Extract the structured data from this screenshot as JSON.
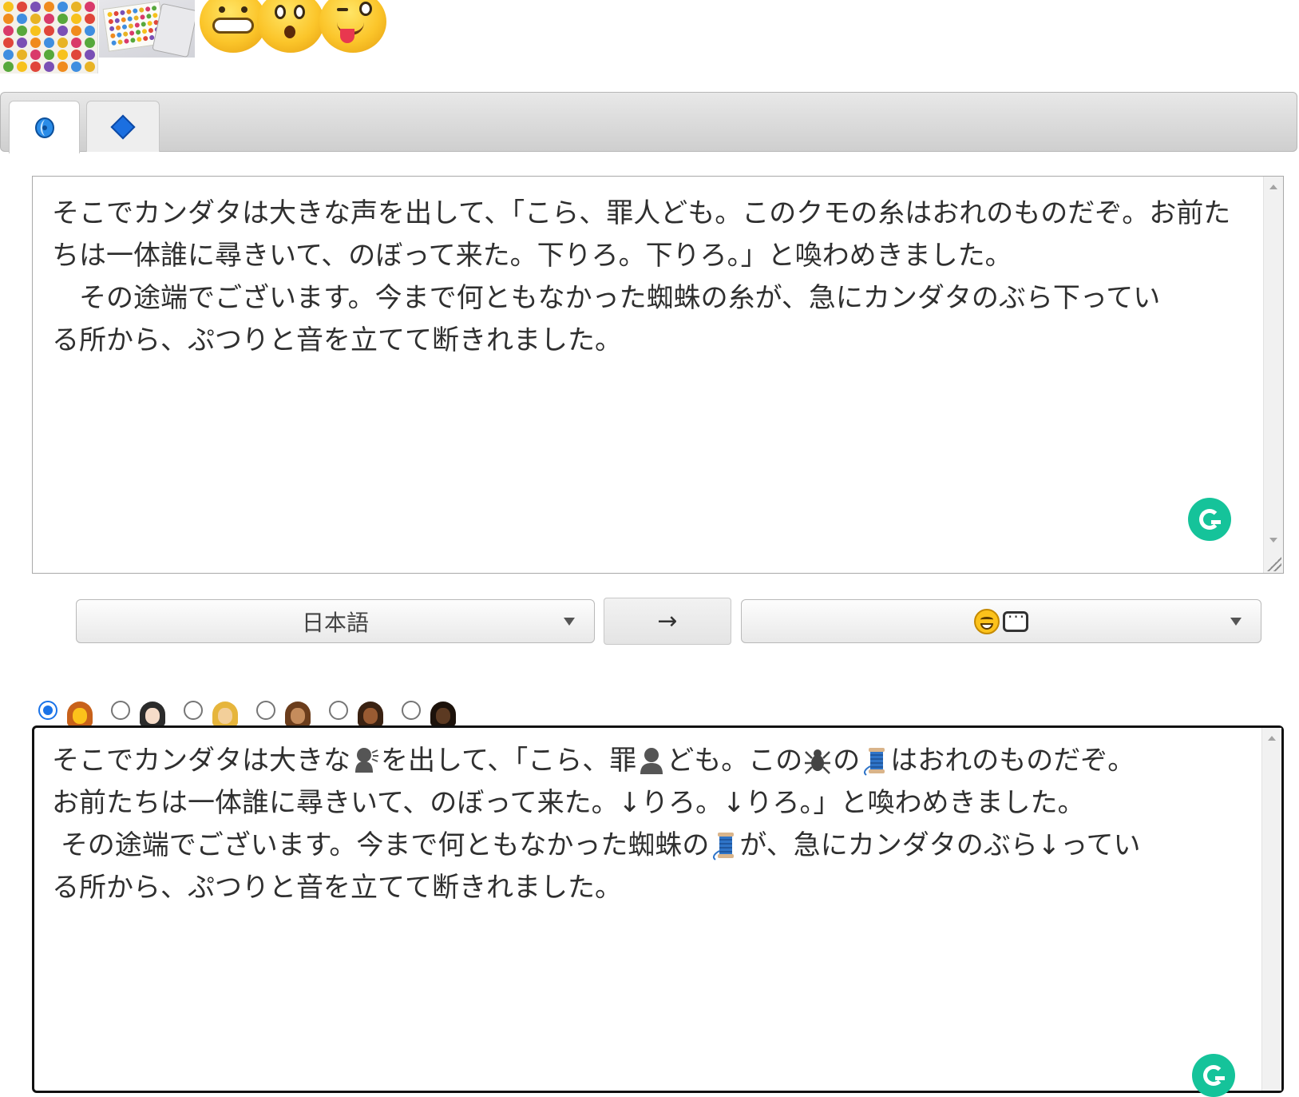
{
  "top_images": {
    "items": [
      "emoji-grid-image",
      "emoji-keyboard-image",
      "emoji-faces-image"
    ]
  },
  "tabs": [
    {
      "name": "translate-tab",
      "icon": "swirl-icon",
      "active": true
    },
    {
      "name": "emoji-tab",
      "icon": "diamond-icon",
      "active": false
    }
  ],
  "input": {
    "text": "そこでカンダタは大きな声を出して、「こら、罪人ども。このクモの糸はおれのものだぞ。お前たちは一体誰に尋きいて、のぼって来た。下りろ。下りろ。」と喚わめきました。\n　その途端でございます。今まで何ともなかった蜘蛛の糸が、急にカンダタのぶら下ってい\nる所から、ぷつりと音を立てて断きれました。"
  },
  "controls": {
    "source_language": "日本語",
    "swap_label": "→",
    "target_language_icons": [
      "grinning-face-icon",
      "speech-bubble-icon"
    ]
  },
  "skin_tones": {
    "selected_index": 0,
    "options": [
      "default",
      "light",
      "medium-light",
      "medium",
      "medium-dark",
      "dark"
    ],
    "colors": [
      {
        "hair": "#c8611a",
        "skin": "#fcc21b"
      },
      {
        "hair": "#2b2b2b",
        "skin": "#f6dcc9"
      },
      {
        "hair": "#e6b53c",
        "skin": "#f3cf9a"
      },
      {
        "hair": "#6b3d1c",
        "skin": "#c58c5c"
      },
      {
        "hair": "#3a2212",
        "skin": "#9a5b32"
      },
      {
        "hair": "#1c120b",
        "skin": "#5c3a22"
      }
    ]
  },
  "output": {
    "segments": [
      {
        "t": "そこでカンダタは大きな"
      },
      {
        "emoji": "speaking-head-icon"
      },
      {
        "t": "を出して、「こら、罪"
      },
      {
        "emoji": "person-silhouette-icon"
      },
      {
        "t": "ども。この"
      },
      {
        "emoji": "spider-icon"
      },
      {
        "t": "の"
      },
      {
        "emoji": "thread-spool-icon"
      },
      {
        "t": "はおれのものだぞ。\nお前たちは一体誰に尋きいて、のぼって来た。↓りろ。↓りろ。」と喚わめきました。\n その途端でございます。今まで何ともなかった蜘蛛の"
      },
      {
        "emoji": "thread-spool-icon"
      },
      {
        "t": "が、急にカンダタのぶら↓ってい\nる所から、ぷつりと音を立てて断きれました。"
      }
    ]
  },
  "colors": {
    "accent": "#1a73e8",
    "grammarly": "#15c39a"
  }
}
